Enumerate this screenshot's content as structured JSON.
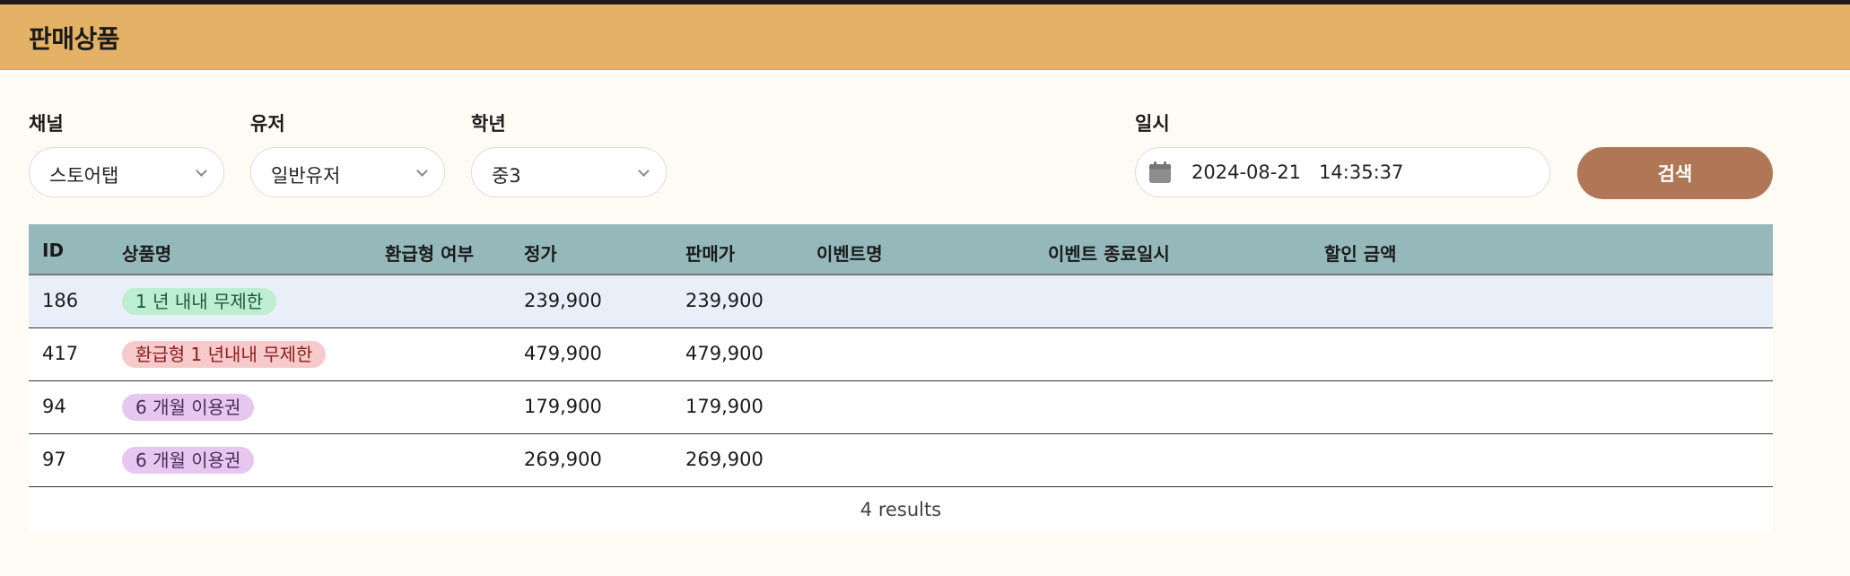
{
  "header": {
    "title": "판매상품"
  },
  "filters": {
    "channel": {
      "label": "채널",
      "value": "스토어탭"
    },
    "user": {
      "label": "유저",
      "value": "일반유저"
    },
    "grade": {
      "label": "학년",
      "value": "중3"
    },
    "datetime": {
      "label": "일시",
      "value": "2024-08-21   14:35:37"
    },
    "search_label": "검색"
  },
  "table": {
    "columns": [
      "ID",
      "상품명",
      "환급형 여부",
      "정가",
      "판매가",
      "이벤트명",
      "이벤트 종료일시",
      "할인 금액"
    ],
    "rows": [
      {
        "id": "186",
        "name": "1 년 내내 무제한",
        "tag_color": "green",
        "refund": "",
        "price": "239,900",
        "sale": "239,900",
        "event": "",
        "event_end": "",
        "discount": ""
      },
      {
        "id": "417",
        "name": "환급형 1 년내내 무제한",
        "tag_color": "red",
        "refund": "",
        "price": "479,900",
        "sale": "479,900",
        "event": "",
        "event_end": "",
        "discount": ""
      },
      {
        "id": "94",
        "name": "6 개월 이용권",
        "tag_color": "purple",
        "refund": "",
        "price": "179,900",
        "sale": "179,900",
        "event": "",
        "event_end": "",
        "discount": ""
      },
      {
        "id": "97",
        "name": "6 개월 이용권",
        "tag_color": "purple",
        "refund": "",
        "price": "269,900",
        "sale": "269,900",
        "event": "",
        "event_end": "",
        "discount": ""
      }
    ],
    "footer": "4 results"
  },
  "colors": {
    "header_bg": "#e3b266",
    "table_header_bg": "#95b8bb",
    "search_button_bg": "#b07757",
    "selected_row_bg": "#e9eff8",
    "tag_green": "#bdeed2",
    "tag_red": "#f6caca",
    "tag_purple": "#e6c7ef"
  },
  "icons": {
    "date_field": "calendar-icon",
    "select_toggle": "chevron-down-icon"
  }
}
